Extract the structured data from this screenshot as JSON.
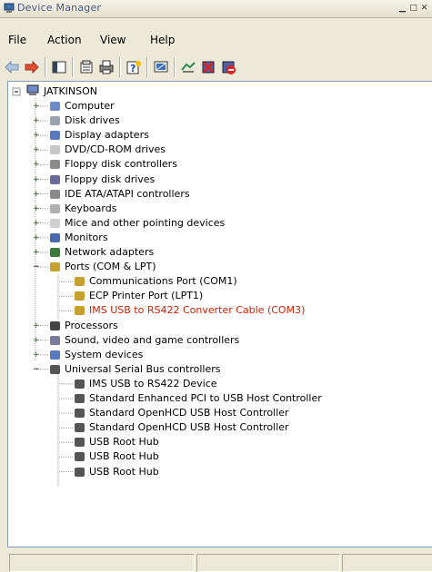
{
  "window": {
    "title": "Device Manager"
  },
  "menu": [
    "File",
    "Action",
    "View",
    "Help"
  ],
  "toolbar": {
    "icons": [
      "back-arrow-icon",
      "forward-arrow-icon",
      "console-tree-icon",
      "properties-icon",
      "print-icon",
      "help-icon",
      "scan-hardware-icon",
      "update-driver-icon",
      "uninstall-icon",
      "disable-icon"
    ]
  },
  "tree": {
    "root": "JATKINSON",
    "categories": [
      {
        "label": "Computer",
        "icon": "computer-icon"
      },
      {
        "label": "Disk drives",
        "icon": "disk-icon"
      },
      {
        "label": "Display adapters",
        "icon": "display-icon"
      },
      {
        "label": "DVD/CD-ROM drives",
        "icon": "cdrom-icon"
      },
      {
        "label": "Floppy disk controllers",
        "icon": "controller-icon"
      },
      {
        "label": "Floppy disk drives",
        "icon": "floppy-icon"
      },
      {
        "label": "IDE ATA/ATAPI controllers",
        "icon": "controller-icon"
      },
      {
        "label": "Keyboards",
        "icon": "keyboard-icon"
      },
      {
        "label": "Mice and other pointing devices",
        "icon": "mouse-icon"
      },
      {
        "label": "Monitors",
        "icon": "monitor-icon"
      },
      {
        "label": "Network adapters",
        "icon": "network-icon"
      },
      {
        "label": "Ports (COM & LPT)",
        "icon": "port-icon",
        "expanded": true,
        "children": [
          {
            "label": "Communications Port (COM1)",
            "icon": "port-icon"
          },
          {
            "label": "ECP Printer Port (LPT1)",
            "icon": "port-icon"
          },
          {
            "label": "IMS USB to RS422 Converter Cable (COM3)",
            "icon": "port-icon",
            "highlight": true
          }
        ]
      },
      {
        "label": "Processors",
        "icon": "processor-icon"
      },
      {
        "label": "Sound, video and game controllers",
        "icon": "sound-icon"
      },
      {
        "label": "System devices",
        "icon": "system-icon"
      },
      {
        "label": "Universal Serial Bus controllers",
        "icon": "usb-icon",
        "expanded": true,
        "children": [
          {
            "label": "IMS USB to RS422 Device",
            "icon": "usb-icon"
          },
          {
            "label": "Standard Enhanced PCI to USB Host Controller",
            "icon": "usb-icon"
          },
          {
            "label": "Standard OpenHCD USB Host Controller",
            "icon": "usb-icon"
          },
          {
            "label": "Standard OpenHCD USB Host Controller",
            "icon": "usb-icon"
          },
          {
            "label": "USB Root Hub",
            "icon": "usb-icon"
          },
          {
            "label": "USB Root Hub",
            "icon": "usb-icon"
          },
          {
            "label": "USB Root Hub",
            "icon": "usb-icon"
          }
        ]
      }
    ]
  },
  "colors": {
    "highlight_text": "#cc2000",
    "tree_bg": "#ffffff",
    "chrome_bg": "#ece9d8"
  }
}
